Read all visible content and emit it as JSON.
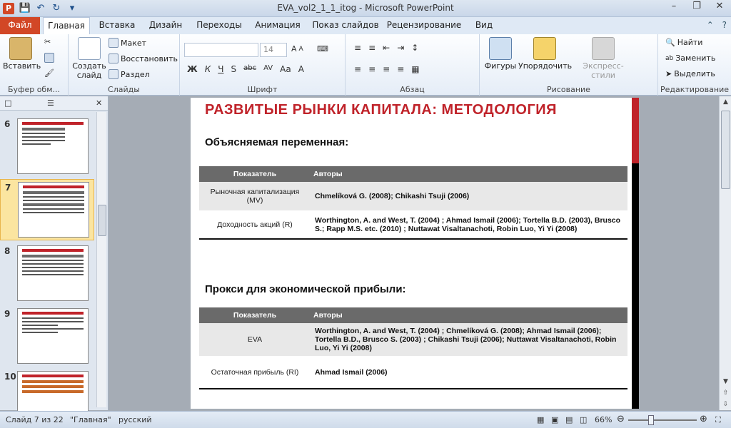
{
  "window": {
    "title": "EVA_vol2_1_1_itog  -  Microsoft PowerPoint",
    "app_letter": "P",
    "qat_icons": [
      "save-icon",
      "undo-icon",
      "redo-icon",
      "customize-icon"
    ],
    "controls": [
      "minimize-icon",
      "restore-icon",
      "close-icon"
    ]
  },
  "tabs": {
    "file": "Файл",
    "items": [
      "Главная",
      "Вставка",
      "Дизайн",
      "Переходы",
      "Анимация",
      "Показ слайдов",
      "Рецензирование",
      "Вид"
    ],
    "active": "Главная"
  },
  "ribbon": {
    "clipboard": {
      "label": "Буфер обм...",
      "paste": "Вставить"
    },
    "slides": {
      "label": "Слайды",
      "new_slide_line1": "Создать",
      "new_slide_line2": "слайд",
      "layout": "Макет",
      "reset": "Восстановить",
      "section": "Раздел"
    },
    "font": {
      "label": "Шрифт",
      "font_size": "14",
      "buttons": [
        "Ж",
        "К",
        "Ч",
        "S",
        "abc",
        "AV",
        "Aa",
        "A"
      ]
    },
    "paragraph": {
      "label": "Абзац"
    },
    "drawing": {
      "label": "Рисование",
      "shapes": "Фигуры",
      "arrange": "Упорядочить",
      "quick_styles": "Экспресс-стили"
    },
    "editing": {
      "label": "Редактирование",
      "find": "Найти",
      "replace": "Заменить",
      "select": "Выделить"
    }
  },
  "slides_panel": {
    "thumbnails": [
      {
        "num": "6"
      },
      {
        "num": "7",
        "selected": true
      },
      {
        "num": "8"
      },
      {
        "num": "9"
      },
      {
        "num": "10"
      }
    ]
  },
  "slide": {
    "title": "РАЗВИТЫЕ  РЫНКИ КАПИТАЛА: МЕТОДОЛОГИЯ",
    "section1": {
      "heading": "Объясняемая переменная:",
      "col1": "Показатель",
      "col2": "Авторы",
      "rows": [
        {
          "indicator": "Рыночная  капитализация (MV)",
          "authors": "Chmelíková G. (2008);  Chikashi Tsuji (2006)"
        },
        {
          "indicator": "Доходность акций  (R)",
          "authors": "Worthington, A. and West, T. (2004) ; Ahmad Ismail (2006);  Tortella B.D.  (2003), Brusco S.;  Rapp M.S. etc. (2010) ; Nuttawat Visaltanachoti, Robin Luo, Yi Yi (2008)"
        }
      ]
    },
    "section2": {
      "heading": "Прокси для экономической прибыли:",
      "col1": "Показатель",
      "col2": "Авторы",
      "rows": [
        {
          "indicator": "EVA",
          "authors": "Worthington, A. and West, T. (2004) ; Chmelíková G. (2008); Ahmad Ismail (2006);  Tortella B.D.,  Brusco S. (2003) ;  Chikashi Tsuji (2006);  Nuttawat Visaltanachoti, Robin Luo, Yi Yi (2008)"
        },
        {
          "indicator": "Остаточная прибыль  (RI)",
          "authors": "Ahmad Ismail  (2006)"
        }
      ]
    }
  },
  "status": {
    "slide_info": "Слайд 7 из 22",
    "theme": "\"Главная\"",
    "language": "русский",
    "zoom": "66%"
  }
}
